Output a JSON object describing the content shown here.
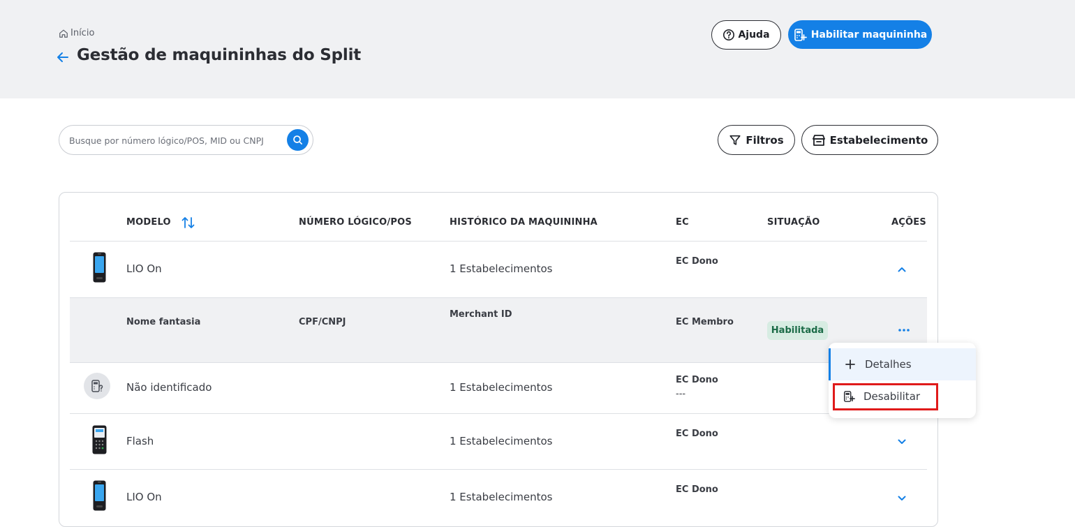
{
  "header": {
    "breadcrumb": "Início",
    "title": "Gestão de maquininhas do Split",
    "help_label": "Ajuda",
    "enable_label": "Habilitar maquininha"
  },
  "toolbar": {
    "search_placeholder": "Busque por número lógico/POS, MID ou CNPJ",
    "filter_label": "Filtros",
    "estab_label": "Estabelecimento"
  },
  "table": {
    "columns": [
      "MODELO",
      "NÚMERO LÓGICO/POS",
      "HISTÓRICO DA MAQUININHA",
      "EC",
      "SITUAÇÃO",
      "AÇÕES"
    ],
    "rows": [
      {
        "model": "LIO On",
        "history": "1 Estabelecimentos",
        "ec": "EC Dono",
        "ec_sub": ""
      },
      {
        "model": "Não identificado",
        "history": "1 Estabelecimentos",
        "ec": "EC Dono",
        "ec_sub": "---"
      },
      {
        "model": "Flash",
        "history": "1 Estabelecimentos",
        "ec": "EC Dono",
        "ec_sub": ""
      },
      {
        "model": "LIO On",
        "history": "1 Estabelecimentos",
        "ec": "EC Dono",
        "ec_sub": ""
      }
    ],
    "sub_row": {
      "name": "Nome fantasia",
      "doc": "CPF/CNPJ",
      "merchant": "Merchant ID",
      "ec": "EC Membro",
      "status": "Habilitada"
    }
  },
  "menu": {
    "details_label": "Detalhes",
    "disable_label": "Desabilitar"
  },
  "colors": {
    "primary": "#1480e6",
    "header_bg": "#f0f1f3",
    "badge_bg": "#d7ece2",
    "badge_text": "#1b6b47",
    "highlight": "#e01a1a"
  }
}
